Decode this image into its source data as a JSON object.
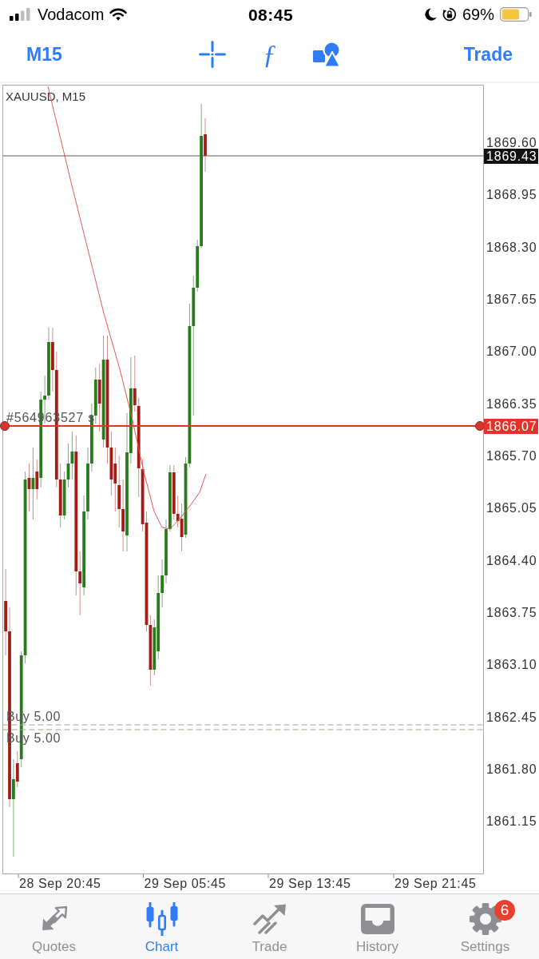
{
  "status_bar": {
    "carrier": "Vodacom",
    "time": "08:45",
    "battery": "69%"
  },
  "toolbar": {
    "timeframe": "M15",
    "indicator_glyph": "ƒ",
    "trade": "Trade"
  },
  "chart": {
    "symbol": "XAUUSD, M15",
    "price_axis": [
      "1869.60",
      "1868.95",
      "1868.30",
      "1867.65",
      "1867.00",
      "1866.35",
      "1865.70",
      "1865.05",
      "1864.40",
      "1863.75",
      "1863.10",
      "1862.45",
      "1861.80",
      "1861.15"
    ],
    "time_axis": [
      "28 Sep 20:45",
      "29 Sep 05:45",
      "29 Sep 13:45",
      "29 Sep 21:45"
    ],
    "current_price": {
      "label": "1869.43"
    },
    "order_line": {
      "text": "#564963527 s",
      "label": "1866.07"
    },
    "pending_orders": [
      {
        "text": "Buy 5.00"
      },
      {
        "text": "Buy 5.00"
      }
    ]
  },
  "tabs": [
    {
      "label": "Quotes",
      "selected": false
    },
    {
      "label": "Chart",
      "selected": true
    },
    {
      "label": "Trade",
      "selected": false
    },
    {
      "label": "History",
      "selected": false
    },
    {
      "label": "Settings",
      "selected": false,
      "badge": "6"
    }
  ]
}
